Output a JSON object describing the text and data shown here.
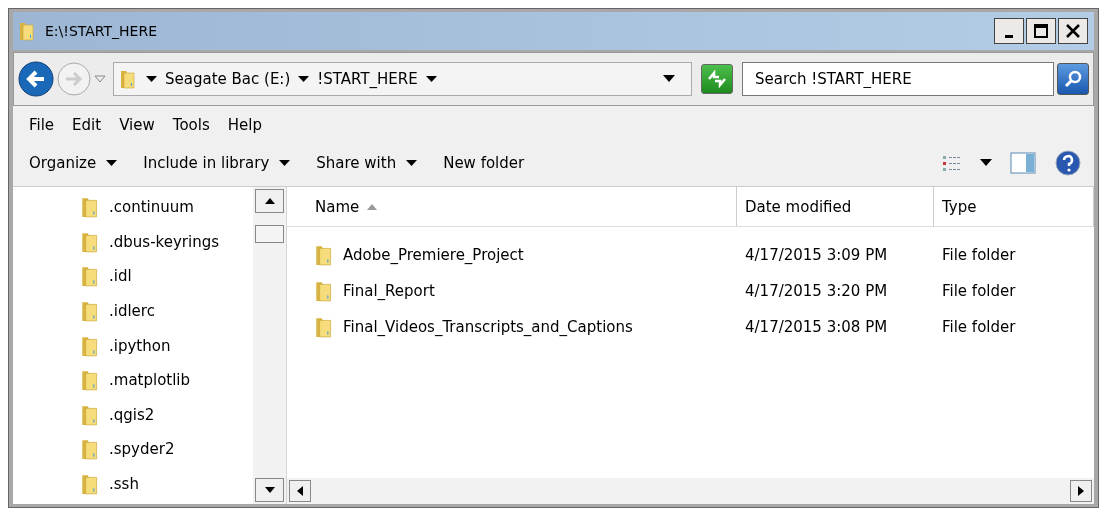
{
  "window": {
    "title": "E:\\!START_HERE"
  },
  "address_bar": {
    "crumbs": [
      "Seagate Bac (E:)",
      "!START_HERE"
    ]
  },
  "search": {
    "placeholder": "Search !START_HERE"
  },
  "menu": [
    "File",
    "Edit",
    "View",
    "Tools",
    "Help"
  ],
  "toolbar": [
    {
      "label": "Organize",
      "dropdown": true
    },
    {
      "label": "Include in library",
      "dropdown": true
    },
    {
      "label": "Share with",
      "dropdown": true
    },
    {
      "label": "New folder",
      "dropdown": false
    }
  ],
  "navigation": {
    "items": [
      ".continuum",
      ".dbus-keyrings",
      ".idl",
      ".idlerc",
      ".ipython",
      ".matplotlib",
      ".qgis2",
      ".spyder2",
      ".ssh"
    ]
  },
  "table": {
    "columns": [
      {
        "label": "Name",
        "sorted": true
      },
      {
        "label": "Date modified",
        "sorted": false
      },
      {
        "label": "Type",
        "sorted": false
      }
    ],
    "rows": [
      {
        "name": "Adobe_Premiere_Project",
        "date": "4/17/2015 3:09 PM",
        "type": "File folder"
      },
      {
        "name": "Final_Report",
        "date": "4/17/2015 3:20 PM",
        "type": "File folder"
      },
      {
        "name": "Final_Videos_Transcripts_and_Captions",
        "date": "4/17/2015 3:08 PM",
        "type": "File folder"
      }
    ]
  }
}
